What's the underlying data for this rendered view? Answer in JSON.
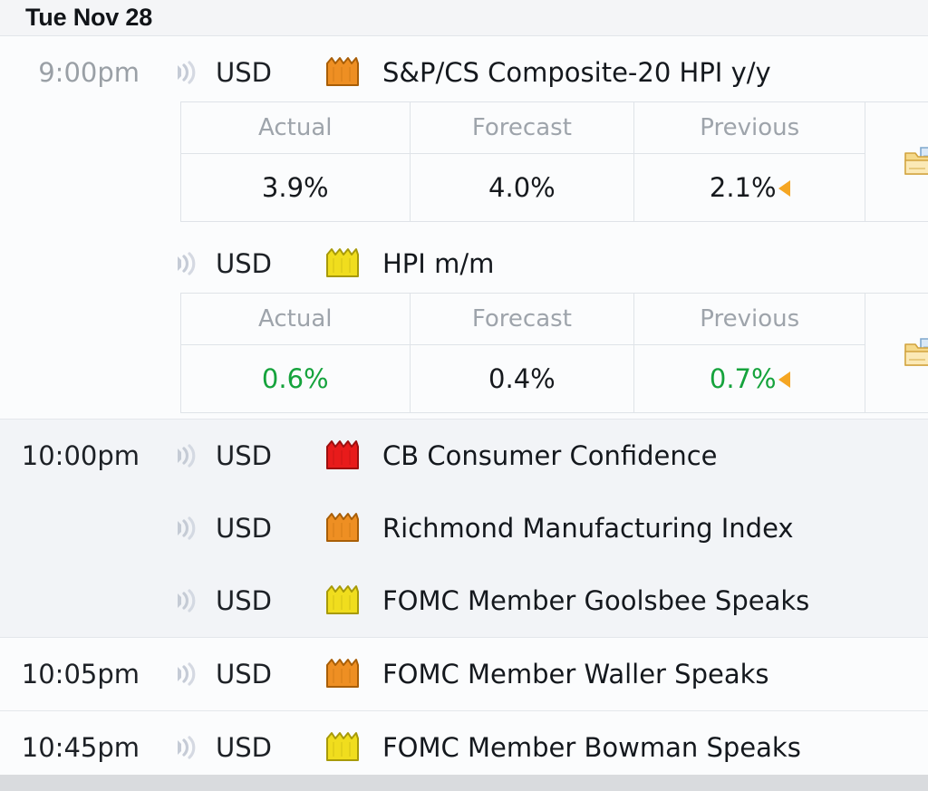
{
  "app": {
    "name": "economic-calendar",
    "day_header": "Tue Nov 28"
  },
  "columns": {
    "actual": "Actual",
    "forecast": "Forecast",
    "previous": "Previous"
  },
  "colors": {
    "impact_high": "#e81b1b",
    "impact_medium": "#ee8f23",
    "impact_low": "#f0dd1e",
    "value_better": "#15a33c",
    "value_neutral": "#16191d",
    "revision_marker": "#f5a623",
    "muted_text": "#9aa0a6"
  },
  "icons": {
    "alert": "sound-wave-icon",
    "impact": "impact-folder-icon",
    "detail": "folder-document-icon",
    "graph": "bar-chart-icon",
    "revision": "revision-triangle-icon"
  },
  "groups": [
    {
      "time": "9:00pm",
      "time_muted": true,
      "shade": "white",
      "events": [
        {
          "currency": "USD",
          "impact": "medium",
          "title": "S&P/CS Composite-20 HPI y/y",
          "has_detail": true,
          "detail": {
            "actual": {
              "text": "3.9%",
              "tone": "black",
              "revised": false
            },
            "forecast": {
              "text": "4.0%",
              "tone": "black",
              "revised": false
            },
            "previous": {
              "text": "2.1%",
              "tone": "black",
              "revised": true
            }
          }
        },
        {
          "currency": "USD",
          "impact": "low",
          "title": "HPI m/m",
          "has_detail": true,
          "detail": {
            "actual": {
              "text": "0.6%",
              "tone": "green",
              "revised": false
            },
            "forecast": {
              "text": "0.4%",
              "tone": "black",
              "revised": false
            },
            "previous": {
              "text": "0.7%",
              "tone": "green",
              "revised": true
            }
          }
        }
      ]
    },
    {
      "time": "10:00pm",
      "time_muted": false,
      "shade": "gray",
      "events": [
        {
          "currency": "USD",
          "impact": "high",
          "title": "CB Consumer Confidence",
          "has_detail": false
        },
        {
          "currency": "USD",
          "impact": "medium",
          "title": "Richmond Manufacturing Index",
          "has_detail": false
        },
        {
          "currency": "USD",
          "impact": "low",
          "title": "FOMC Member Goolsbee Speaks",
          "has_detail": false
        }
      ]
    },
    {
      "time": "10:05pm",
      "time_muted": false,
      "shade": "white",
      "events": [
        {
          "currency": "USD",
          "impact": "medium",
          "title": "FOMC Member Waller Speaks",
          "has_detail": false
        }
      ]
    },
    {
      "time": "10:45pm",
      "time_muted": false,
      "shade": "white",
      "events": [
        {
          "currency": "USD",
          "impact": "low",
          "title": "FOMC Member Bowman Speaks",
          "has_detail": false
        }
      ]
    }
  ]
}
